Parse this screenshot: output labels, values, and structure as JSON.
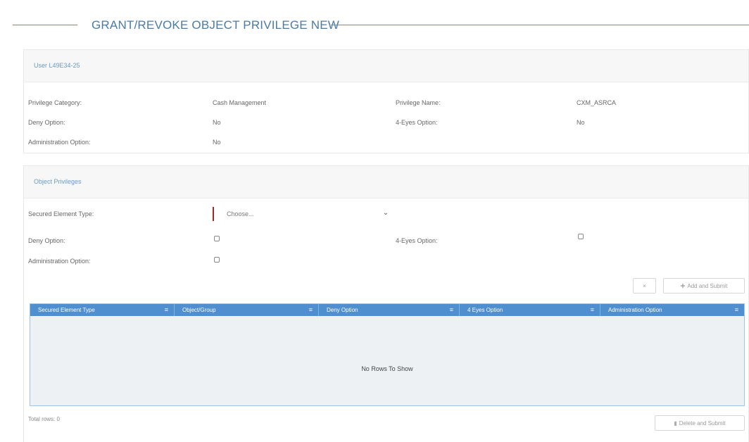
{
  "page": {
    "title": "GRANT/REVOKE OBJECT PRIVILEGE NEW"
  },
  "user_panel": {
    "title": "User L49E34-25",
    "fields": [
      {
        "label": "Privilege Category:",
        "value": "Cash Management"
      },
      {
        "label": "Privilege Name:",
        "value": "CXM_ASRCA"
      },
      {
        "label": "Deny Option:",
        "value": "No"
      },
      {
        "label": "4-Eyes Option:",
        "value": "No"
      },
      {
        "label": "Administration Option:",
        "value": "No"
      }
    ]
  },
  "object_panel": {
    "title": "Object Privileges",
    "secured_element_label": "Secured Element Type:",
    "secured_element_placeholder": "Choose...",
    "deny_label": "Deny Option:",
    "four_eyes_label": "4-Eyes Option:",
    "admin_label": "Administration Option:",
    "deny_checked": false,
    "four_eyes_checked": false,
    "admin_checked": false,
    "clear_button_label": "×",
    "add_button_label": "Add and Submit",
    "grid": {
      "columns": [
        "Secured Element Type",
        "Object/Group",
        "Deny Option",
        "4 Eyes Option",
        "Administration Option"
      ],
      "empty_message": "No Rows To Show"
    },
    "total_rows": "Total rows: 0",
    "delete_button_label": "Delete and Submit"
  },
  "colors": {
    "accent": "#4a7ba6",
    "grid_header": "#4f8fd0",
    "required_marker": "#a02a2a"
  }
}
